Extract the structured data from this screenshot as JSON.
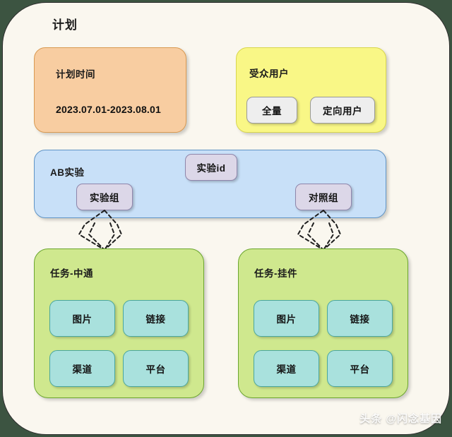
{
  "page": {
    "title": "计划",
    "watermark": "头条 @闪念基因"
  },
  "plan_time": {
    "label": "计划时间",
    "value": "2023.07.01-2023.08.01",
    "color": "#f8cda1"
  },
  "audience": {
    "label": "受众用户",
    "color": "#f9f786",
    "options": [
      {
        "label": "全量"
      },
      {
        "label": "定向用户"
      }
    ]
  },
  "ab_experiment": {
    "label": "AB实验",
    "color": "#c8e0f8",
    "experiment_id": {
      "label": "实验id"
    },
    "groups": [
      {
        "label": "实验组"
      },
      {
        "label": "对照组"
      }
    ]
  },
  "tasks": [
    {
      "label": "任务-中通",
      "color": "#cfe88e",
      "items": [
        {
          "label": "图片"
        },
        {
          "label": "链接"
        },
        {
          "label": "渠道"
        },
        {
          "label": "平台"
        }
      ]
    },
    {
      "label": "任务-挂件",
      "color": "#cfe88e",
      "items": [
        {
          "label": "图片"
        },
        {
          "label": "链接"
        },
        {
          "label": "渠道"
        },
        {
          "label": "平台"
        }
      ]
    }
  ],
  "connectors": [
    {
      "name": "experiment-group-to-task-zhongtong",
      "style": "dashed"
    },
    {
      "name": "control-group-to-task-guajian",
      "style": "dashed"
    }
  ]
}
